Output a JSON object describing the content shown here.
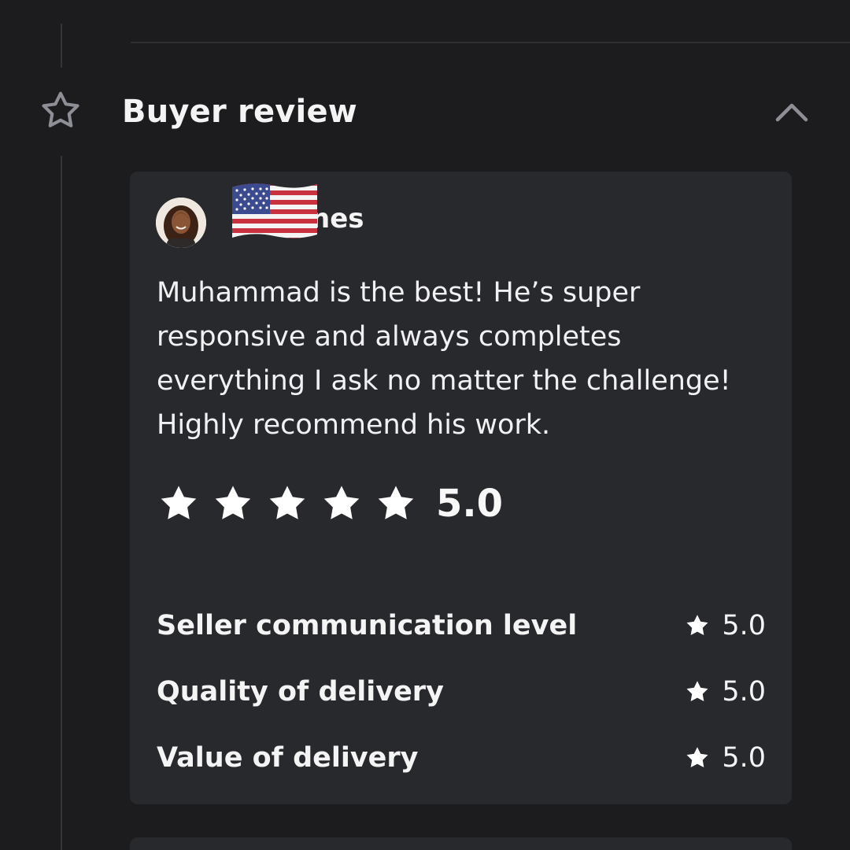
{
  "section": {
    "title": "Buyer review",
    "icon": "star-outline-icon",
    "collapse_icon": "chevron-up-icon"
  },
  "review": {
    "reviewer_name": "nes",
    "flag": "us-flag-icon",
    "text": "Muhammad is the best! He’s super responsive and always completes everything I ask no matter the challenge! Highly recommend his work.",
    "star_count": 5,
    "overall_rating": "5.0",
    "breakdown": [
      {
        "label": "Seller communication level",
        "value": "5.0"
      },
      {
        "label": "Quality of delivery",
        "value": "5.0"
      },
      {
        "label": "Value of delivery",
        "value": "5.0"
      }
    ]
  },
  "colors": {
    "background": "#1c1c1e",
    "card": "#28292d",
    "text": "#f4f4f5",
    "muted_icon": "#8e8f96"
  }
}
